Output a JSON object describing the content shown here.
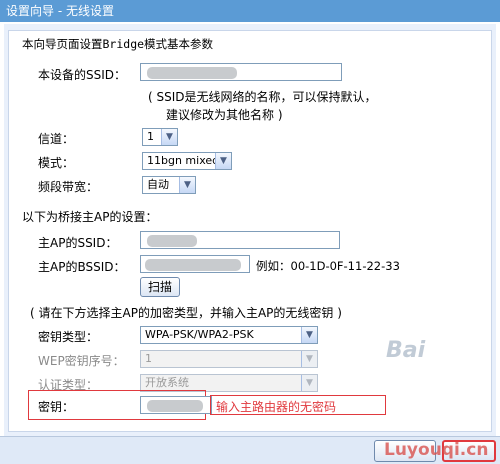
{
  "window": {
    "title": "设置向导 - 无线设置"
  },
  "intro": "本向导页面设置Bridge模式基本参数",
  "ssid": {
    "label": "本设备的SSID：",
    "note_line1": "( SSID是无线网络的名称，可以保持默认，",
    "note_line2": "建议修改为其他名称 )"
  },
  "channel": {
    "label": "信道：",
    "value": "1"
  },
  "mode": {
    "label": "模式：",
    "value": "11bgn mixed"
  },
  "bandwidth": {
    "label": "频段带宽：",
    "value": "自动"
  },
  "bridge_section": {
    "title": "以下为桥接主AP的设置："
  },
  "main_ap_ssid": {
    "label": "主AP的SSID："
  },
  "main_ap_bssid": {
    "label": "主AP的BSSID：",
    "example": "例如：00-1D-0F-11-22-33"
  },
  "scan_button": "扫描",
  "encryption_note": "( 请在下方选择主AP的加密类型，并输入主AP的无线密钥 )",
  "key_type": {
    "label": "密钥类型：",
    "value": "WPA-PSK/WPA2-PSK"
  },
  "wep_index": {
    "label": "WEP密钥序号：",
    "value": "1"
  },
  "auth_type": {
    "label": "认证类型：",
    "value": "开放系统"
  },
  "key": {
    "label": "密钥：",
    "hint": "输入主路由器的无密码"
  },
  "watermarks": {
    "baidu": "Bai",
    "site": "Luyouqi.cn"
  },
  "colors": {
    "titlebar": "#5b9bd5",
    "highlight": "#e0393e"
  }
}
